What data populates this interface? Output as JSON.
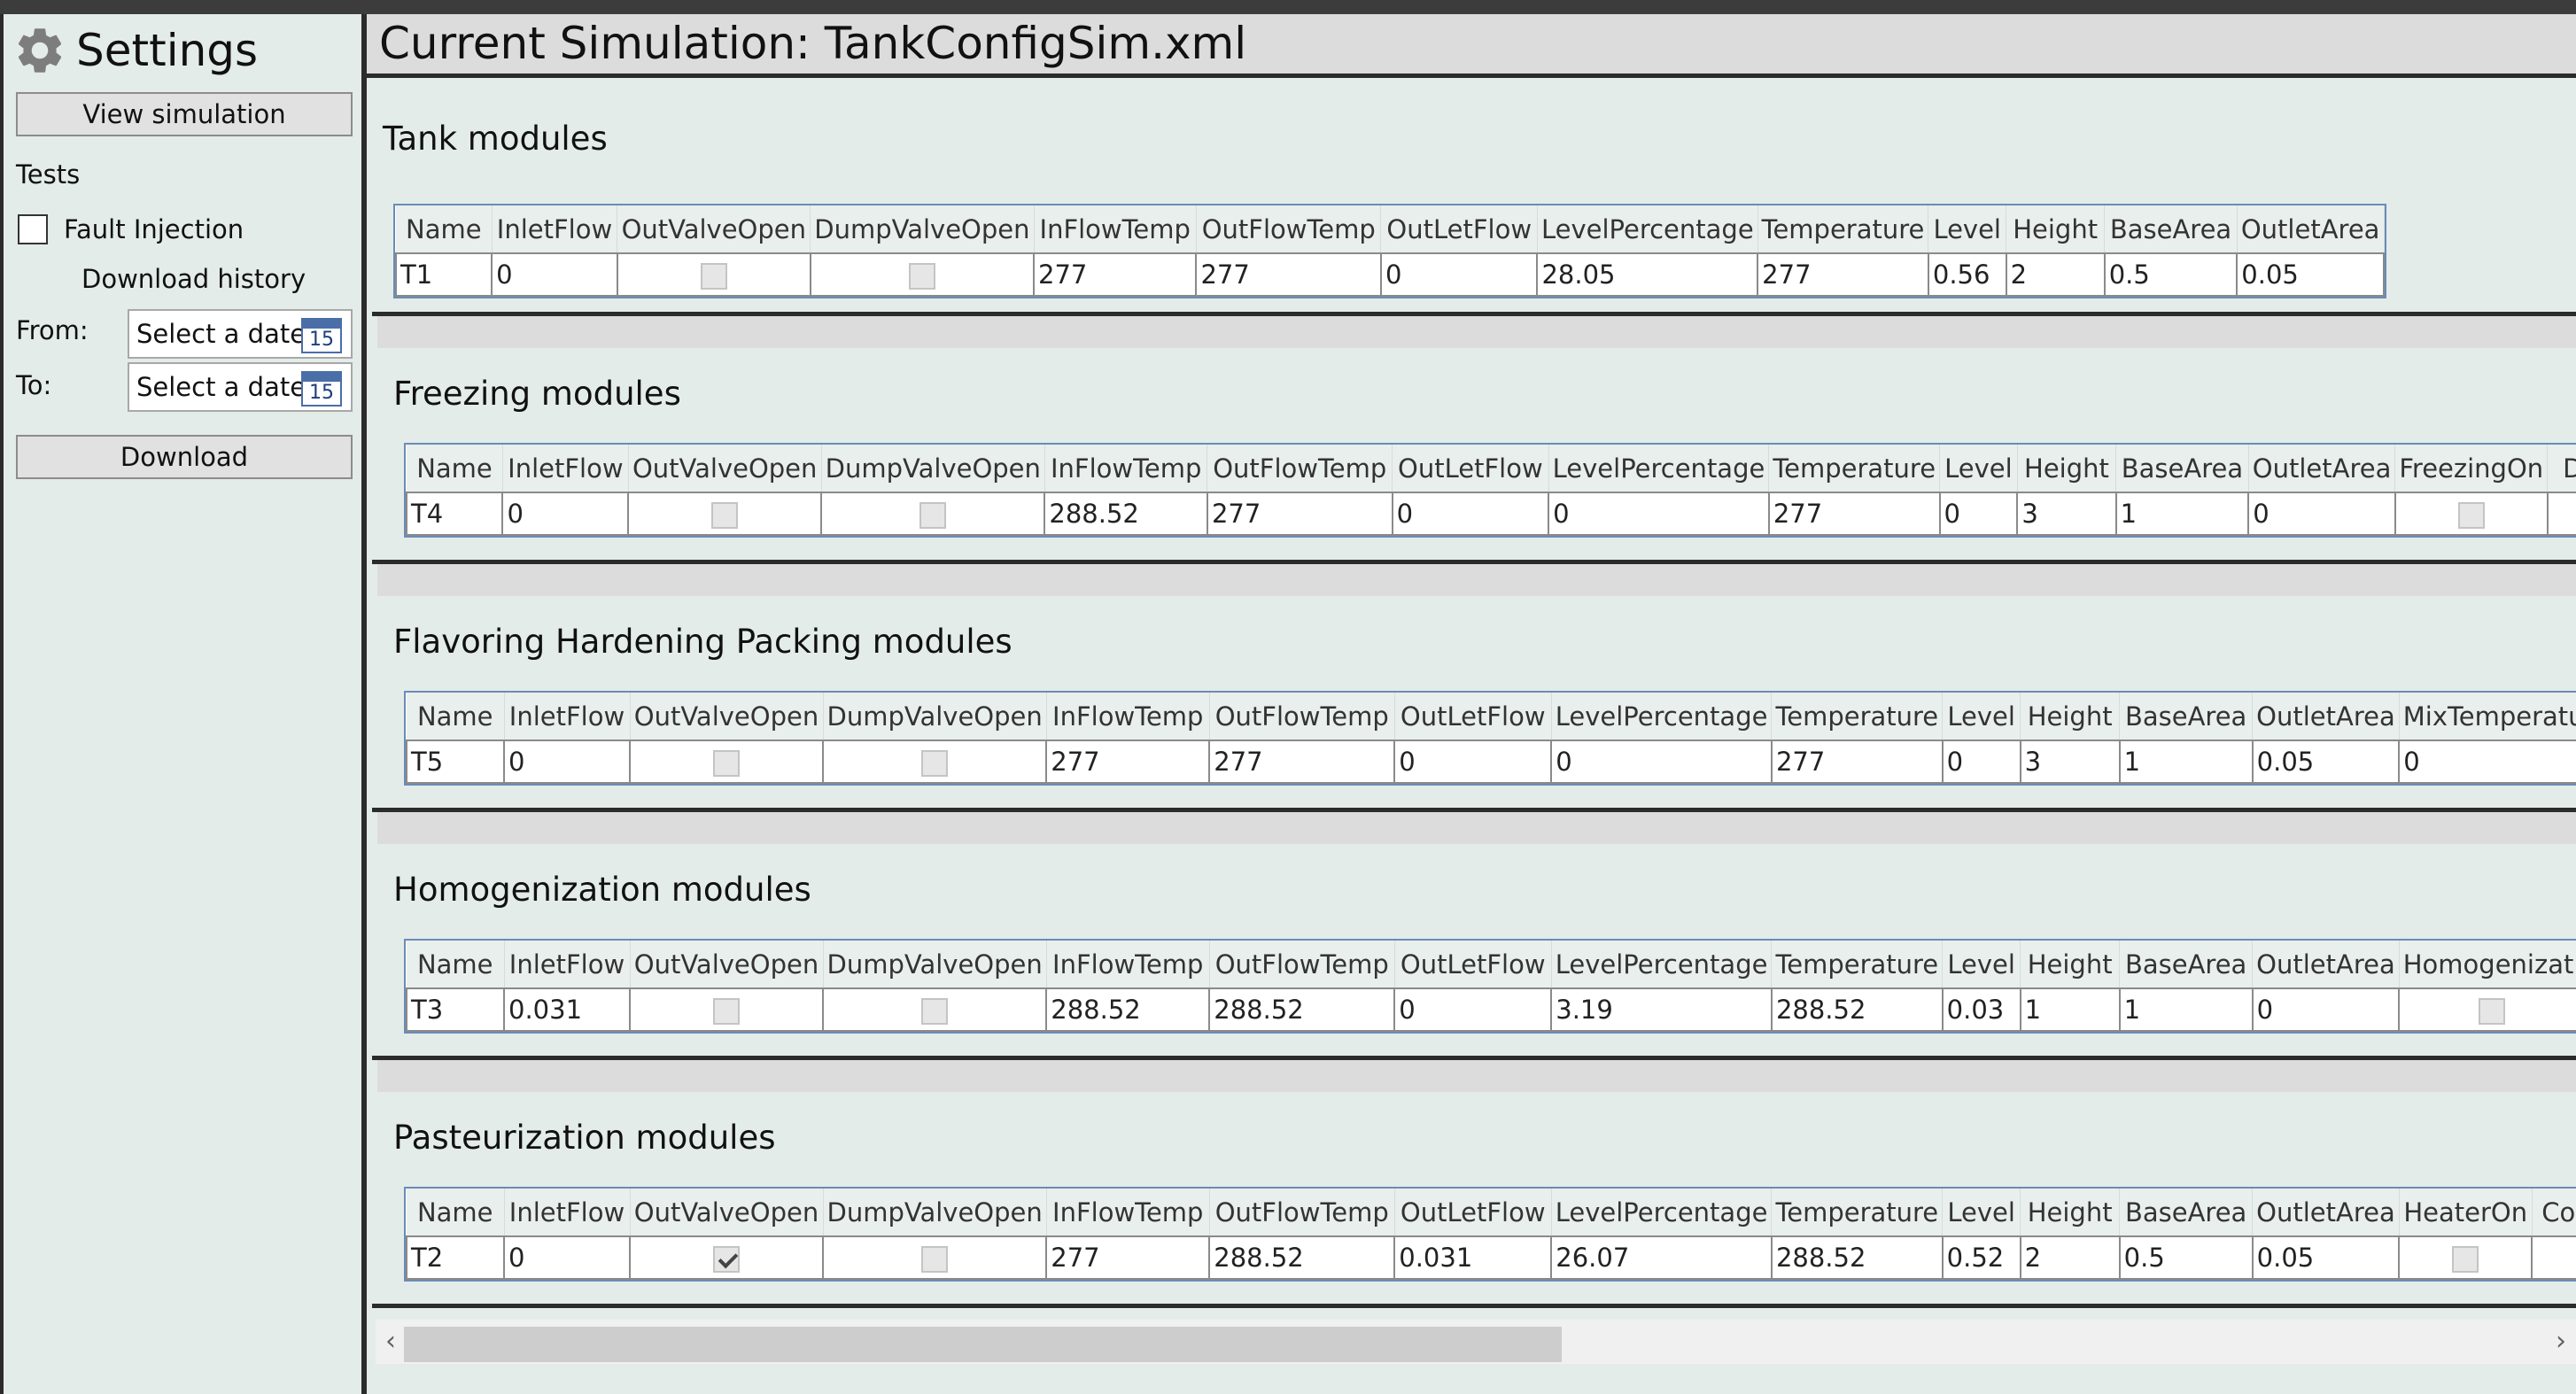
{
  "sidebar": {
    "title": "Settings",
    "view_simulation": "View simulation",
    "tests_label": "Tests",
    "fault_injection": "Fault Injection",
    "fault_injection_checked": false,
    "download_history": "Download history",
    "from_label": "From:",
    "to_label": "To:",
    "from_placeholder": "Select a date",
    "to_placeholder": "Select a date",
    "calendar_day": "15",
    "download": "Download"
  },
  "header": {
    "title": "Current Simulation: TankConfigSim.xml"
  },
  "sections": {
    "tank": {
      "title": "Tank modules",
      "columns": [
        "Name",
        "InletFlow",
        "OutValveOpen",
        "DumpValveOpen",
        "InFlowTemp",
        "OutFlowTemp",
        "OutLetFlow",
        "LevelPercentage",
        "Temperature",
        "Level",
        "Height",
        "BaseArea",
        "OutletArea"
      ],
      "row": [
        "T1",
        "0",
        false,
        false,
        "277",
        "277",
        "0",
        "28.05",
        "277",
        "0.56",
        "2",
        "0.5",
        "0.05"
      ]
    },
    "freezing": {
      "title": "Freezing modules",
      "columns": [
        "Name",
        "InletFlow",
        "OutValveOpen",
        "DumpValveOpen",
        "InFlowTemp",
        "OutFlowTemp",
        "OutLetFlow",
        "LevelPercentage",
        "Temperature",
        "Level",
        "Height",
        "BaseArea",
        "OutletArea",
        "FreezingOn",
        "D"
      ],
      "row": [
        "T4",
        "0",
        false,
        false,
        "288.52",
        "277",
        "0",
        "0",
        "277",
        "0",
        "3",
        "1",
        "0",
        false,
        ""
      ]
    },
    "flavoring": {
      "title": "Flavoring Hardening Packing modules",
      "columns": [
        "Name",
        "InletFlow",
        "OutValveOpen",
        "DumpValveOpen",
        "InFlowTemp",
        "OutFlowTemp",
        "OutLetFlow",
        "LevelPercentage",
        "Temperature",
        "Level",
        "Height",
        "BaseArea",
        "OutletArea",
        "MixTemperatu"
      ],
      "row": [
        "T5",
        "0",
        false,
        false,
        "277",
        "277",
        "0",
        "0",
        "277",
        "0",
        "3",
        "1",
        "0.05",
        "0"
      ]
    },
    "homogenization": {
      "title": "Homogenization modules",
      "columns": [
        "Name",
        "InletFlow",
        "OutValveOpen",
        "DumpValveOpen",
        "InFlowTemp",
        "OutFlowTemp",
        "OutLetFlow",
        "LevelPercentage",
        "Temperature",
        "Level",
        "Height",
        "BaseArea",
        "OutletArea",
        "Homogenizati"
      ],
      "row": [
        "T3",
        "0.031",
        false,
        false,
        "288.52",
        "288.52",
        "0",
        "3.19",
        "288.52",
        "0.03",
        "1",
        "1",
        "0",
        false
      ]
    },
    "pasteurization": {
      "title": "Pasteurization modules",
      "columns": [
        "Name",
        "InletFlow",
        "OutValveOpen",
        "DumpValveOpen",
        "InFlowTemp",
        "OutFlowTemp",
        "OutLetFlow",
        "LevelPercentage",
        "Temperature",
        "Level",
        "Height",
        "BaseArea",
        "OutletArea",
        "HeaterOn",
        "Co"
      ],
      "row": [
        "T2",
        "0",
        true,
        false,
        "277",
        "288.52",
        "0.031",
        "26.07",
        "288.52",
        "0.52",
        "2",
        "0.5",
        "0.05",
        false,
        ""
      ]
    }
  },
  "scrollbar": {
    "left_arrow": "‹",
    "right_arrow": "›",
    "thumb_fraction": 0.54
  }
}
